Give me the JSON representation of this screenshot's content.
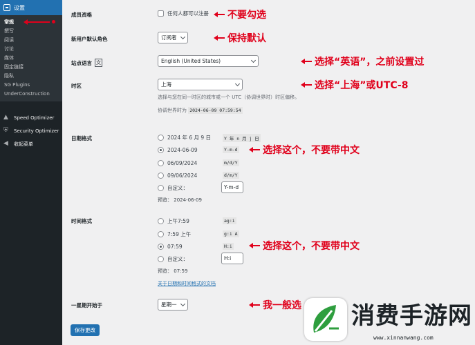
{
  "sidebar": {
    "header": "设置",
    "sub_items": [
      "常规",
      "撰写",
      "阅读",
      "讨论",
      "媒体",
      "固定链接",
      "隐私",
      "SG Plugins",
      "UnderConstruction"
    ],
    "main_items": [
      {
        "label": "Speed Optimizer",
        "icon": "speed-icon"
      },
      {
        "label": "Security Optimizer",
        "icon": "security-icon"
      },
      {
        "label": "收起菜单",
        "icon": "collapse-icon"
      }
    ]
  },
  "membership": {
    "label": "成员资格",
    "checkbox_label": "任何人都可以注册",
    "checked": false
  },
  "default_role": {
    "label": "新用户默认角色",
    "value": "订阅者"
  },
  "site_language": {
    "label": "站点语言",
    "value": "English (United States)"
  },
  "timezone": {
    "label": "时区",
    "value": "上海",
    "help": "选择与您在同一时区的城市或一个 UTC（协调世界时）时区偏移。",
    "utc_label": "协调世界时为",
    "utc_value": "2024-06-09 07:59:54"
  },
  "date_format": {
    "label": "日期格式",
    "options": [
      {
        "text": "2024 年 6 月 9 日",
        "code": "Y 年 n 月 j 日",
        "selected": false
      },
      {
        "text": "2024-06-09",
        "code": "Y-m-d",
        "selected": true
      },
      {
        "text": "06/09/2024",
        "code": "m/d/Y",
        "selected": false
      },
      {
        "text": "09/06/2024",
        "code": "d/m/Y",
        "selected": false
      }
    ],
    "custom_label": "自定义：",
    "custom_value": "Y-m-d",
    "preview_label": "预览：",
    "preview_value": "2024-06-09"
  },
  "time_format": {
    "label": "时间格式",
    "options": [
      {
        "text": "上午7:59",
        "code": "ag:i",
        "selected": false
      },
      {
        "text": "7:59 上午",
        "code": "g:i A",
        "selected": false
      },
      {
        "text": "07:59",
        "code": "H:i",
        "selected": true
      }
    ],
    "custom_label": "自定义：",
    "custom_value": "H:i",
    "preview_label": "预览：",
    "preview_value": "07:59",
    "doc_link": "关于日期和时间格式的文档"
  },
  "week_start": {
    "label": "一星期开始于",
    "value": "星期一"
  },
  "save_button": "保存更改",
  "annotations": {
    "a1": "不要勾选",
    "a2": "保持默认",
    "a3": "选择“英语”，之前设置过",
    "a4": "选择“上海”或UTC-8",
    "a5": "选择这个，不要带中文",
    "a6": "选择这个，不要带中文",
    "a7": "我一般选",
    "color": "#e0001b"
  },
  "watermark": {
    "title": "消费手游网",
    "url": "www.xinnanwang.com"
  }
}
